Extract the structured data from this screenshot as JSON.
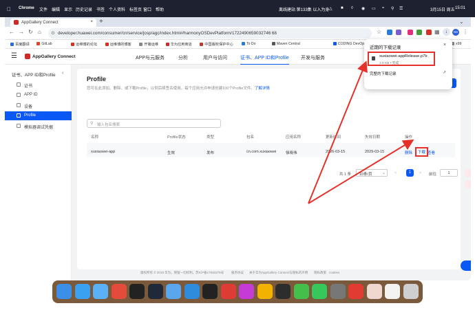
{
  "mac": {
    "app": "Chrome",
    "menus": [
      "文件",
      "编辑",
      "显示",
      "历史记录",
      "书签",
      "个人资料",
      "标签页",
      "窗口",
      "帮助"
    ],
    "status_text": "离线建站 第133集 以入为身",
    "date": "3月15日 周五",
    "time": "15:01"
  },
  "browser": {
    "tab_title": "AppGallery Connect",
    "tab_close": "×",
    "new_tab": "+",
    "url": "developer.huawei.com/consumer/cn/service/josp/agc/index.html#/harmonyOSDevPlatform/1722490659032746 68",
    "profile": "NS"
  },
  "bookmarks": [
    {
      "label": "百度翻译",
      "color": "#2f6be0"
    },
    {
      "label": "GitLab",
      "color": "#e24329"
    },
    {
      "label": "运维博的论坛",
      "color": "#d93025"
    },
    {
      "label": "运维博的博客",
      "color": "#d93025"
    },
    {
      "label": "开播运维",
      "color": "#888888"
    },
    {
      "label": "华为应用商店",
      "color": "#cf2a27"
    },
    {
      "label": "中国版权保护中心",
      "color": "#c0392b"
    },
    {
      "label": "To Do",
      "color": "#2b7cd3"
    },
    {
      "label": "Maven Central",
      "color": "#555555"
    },
    {
      "label": "CODING DevOps...",
      "color": "#0a59f7"
    },
    {
      "label": "邀请码",
      "color": "#888888"
    },
    {
      "label": "WSL",
      "color": "#888888"
    },
    {
      "label": "x99",
      "color": "#888888"
    }
  ],
  "header": {
    "brand": "AppGallery Connect",
    "nav": [
      "APP与元服务",
      "分析",
      "用户与访问",
      "证书、APP ID和Profile",
      "开发与服务"
    ],
    "active_nav": 3
  },
  "sidebar": {
    "title": "证书、APP ID和Profile",
    "items": [
      "证书",
      "APP ID",
      "设备",
      "Profile",
      "模拟器调试凭据"
    ],
    "active": 3
  },
  "page": {
    "title": "Profile",
    "desc": "您可在此添加、删除、或下载Profile，以供后续签名使用。每个应用允许申请创建100个Profile文件。",
    "desc_link": "了解详情",
    "add_button": "添加",
    "search_placeholder": "输入包名搜索"
  },
  "table": {
    "headers": [
      "名称",
      "Profile状态",
      "类型",
      "包名",
      "应用名称",
      "更新时间",
      "失效日期",
      "操作"
    ],
    "rows": [
      {
        "name": "xuxiaowei-app",
        "status": "生效",
        "type": "发布",
        "package": "cn.com.xuxiaowei",
        "app_name": "徐晓伟",
        "updated": "2026-03-15",
        "expires": "2029-03-15",
        "actions": [
          "删除",
          "下载",
          "查看"
        ]
      }
    ]
  },
  "pagination": {
    "total": "共 1 条",
    "page_size": "10条/页",
    "prev": "<",
    "current": "1",
    "next": ">",
    "goto_label": "前往",
    "goto_value": "1"
  },
  "footer": {
    "items": [
      "版权所有 © 2019 华为，保留一切权利。苏ICP备17040376号",
      "服务协议",
      "关于华为AppGallery Connect与隐私的声明",
      "隐私政策",
      "cookies"
    ]
  },
  "downloads": {
    "title": "近期的下载记录",
    "close": "×",
    "file": "xuxiaowei-appRelease.p7b",
    "meta": "3.9 KB • 完成",
    "all": "完整的下载记录"
  },
  "dock_colors": [
    "#3b8fe6",
    "#3aa0f0",
    "#5bb1f5",
    "#e34b3a",
    "#222222",
    "#1f2937",
    "#5aa7f0",
    "#2f8bdc",
    "#222222",
    "#dd3b34",
    "#c43bd6",
    "#f2b200",
    "#2d2d2d",
    "#44c04a",
    "#36c85a",
    "#777777",
    "#e33b32",
    "#f0d8d0",
    "#f3f3f3",
    "#cfcfcf"
  ]
}
